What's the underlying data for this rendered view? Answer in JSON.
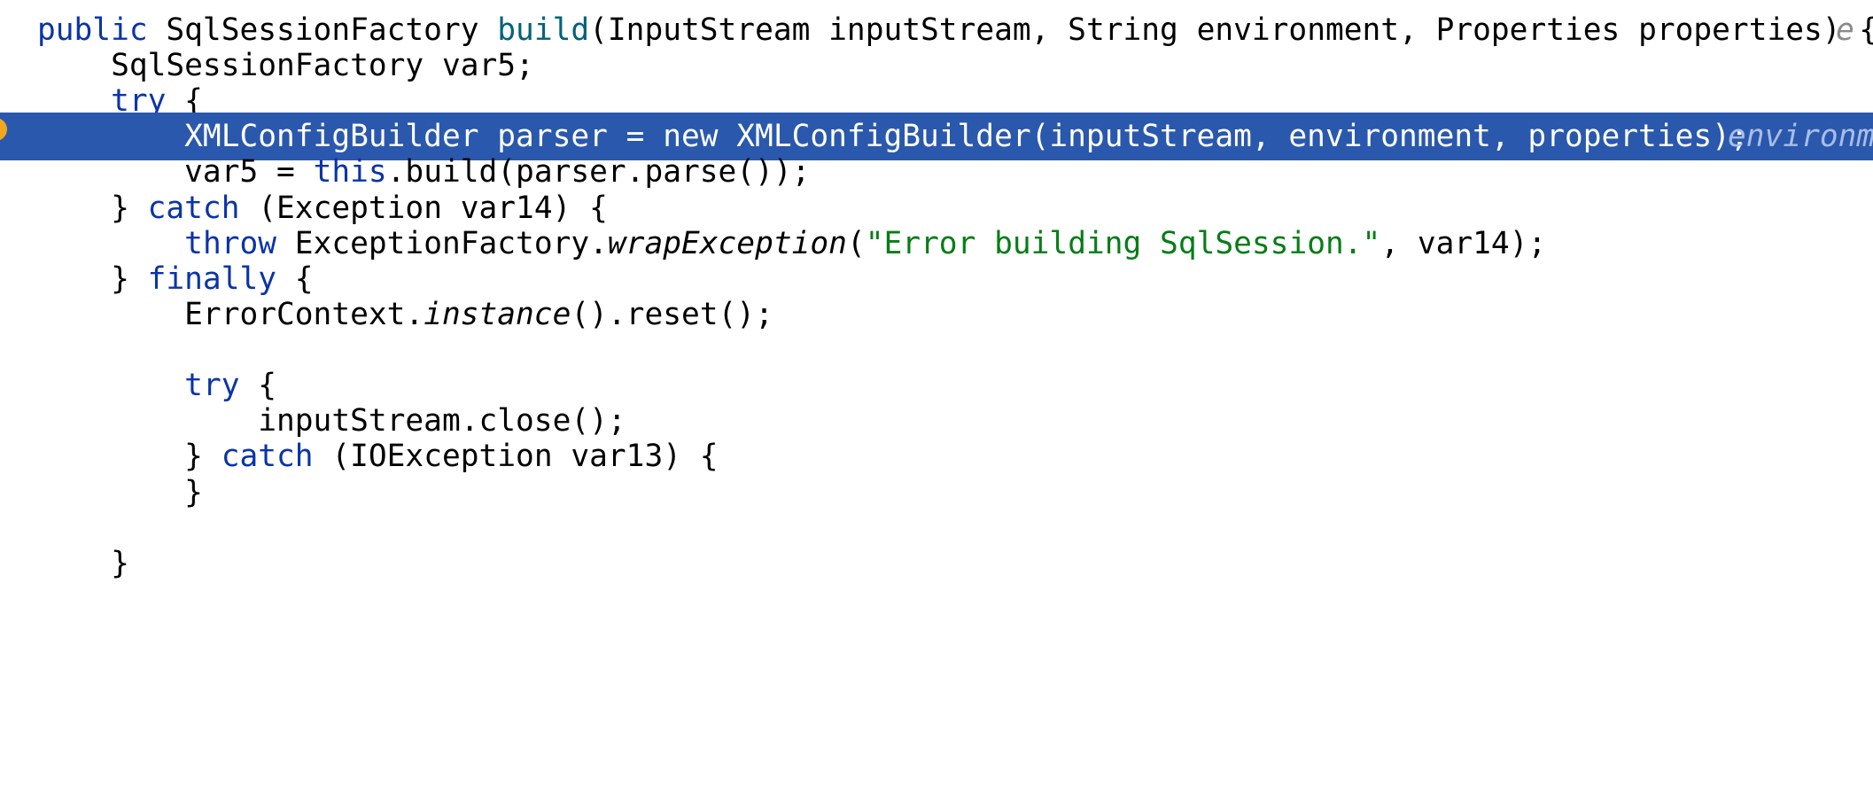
{
  "editor": {
    "lines": [
      {
        "tokens": [
          {
            "t": "public",
            "c": "kw"
          },
          {
            "t": " SqlSessionFactory "
          },
          {
            "t": "build",
            "c": "fn"
          },
          {
            "t": "(InputStream inputStream, String environment, Properties properties) {"
          }
        ],
        "hint": "e"
      },
      {
        "tokens": [
          {
            "t": "    SqlSessionFactory var5;"
          }
        ]
      },
      {
        "tokens": [
          {
            "t": "    "
          },
          {
            "t": "try",
            "c": "kw"
          },
          {
            "t": " {"
          }
        ]
      },
      {
        "highlight": true,
        "breakpoint": true,
        "tokens": [
          {
            "t": "        XMLConfigBuilder parser = new XMLConfigBuilder(inputStream, environment, properties);"
          }
        ],
        "hint": "environm"
      },
      {
        "tokens": [
          {
            "t": "        var5 = "
          },
          {
            "t": "this",
            "c": "kw"
          },
          {
            "t": ".build(parser.parse());"
          }
        ]
      },
      {
        "tokens": [
          {
            "t": "    } "
          },
          {
            "t": "catch",
            "c": "kw"
          },
          {
            "t": " (Exception var14) {"
          }
        ]
      },
      {
        "tokens": [
          {
            "t": "        "
          },
          {
            "t": "throw",
            "c": "kw"
          },
          {
            "t": " ExceptionFactory."
          },
          {
            "t": "wrapException",
            "c": "it"
          },
          {
            "t": "("
          },
          {
            "t": "\"Error building SqlSession.\"",
            "c": "str"
          },
          {
            "t": ", var14);"
          }
        ]
      },
      {
        "tokens": [
          {
            "t": "    } "
          },
          {
            "t": "finally",
            "c": "kw"
          },
          {
            "t": " {"
          }
        ]
      },
      {
        "tokens": [
          {
            "t": "        ErrorContext."
          },
          {
            "t": "instance",
            "c": "it"
          },
          {
            "t": "().reset();"
          }
        ]
      },
      {
        "tokens": []
      },
      {
        "tokens": [
          {
            "t": "        "
          },
          {
            "t": "try",
            "c": "kw"
          },
          {
            "t": " {"
          }
        ]
      },
      {
        "tokens": [
          {
            "t": "            inputStream.close();"
          }
        ]
      },
      {
        "tokens": [
          {
            "t": "        } "
          },
          {
            "t": "catch",
            "c": "kw"
          },
          {
            "t": " (IOException var13) {"
          }
        ]
      },
      {
        "tokens": [
          {
            "t": "        }"
          }
        ]
      },
      {
        "tokens": []
      },
      {
        "tokens": [
          {
            "t": "    }"
          }
        ]
      }
    ]
  }
}
